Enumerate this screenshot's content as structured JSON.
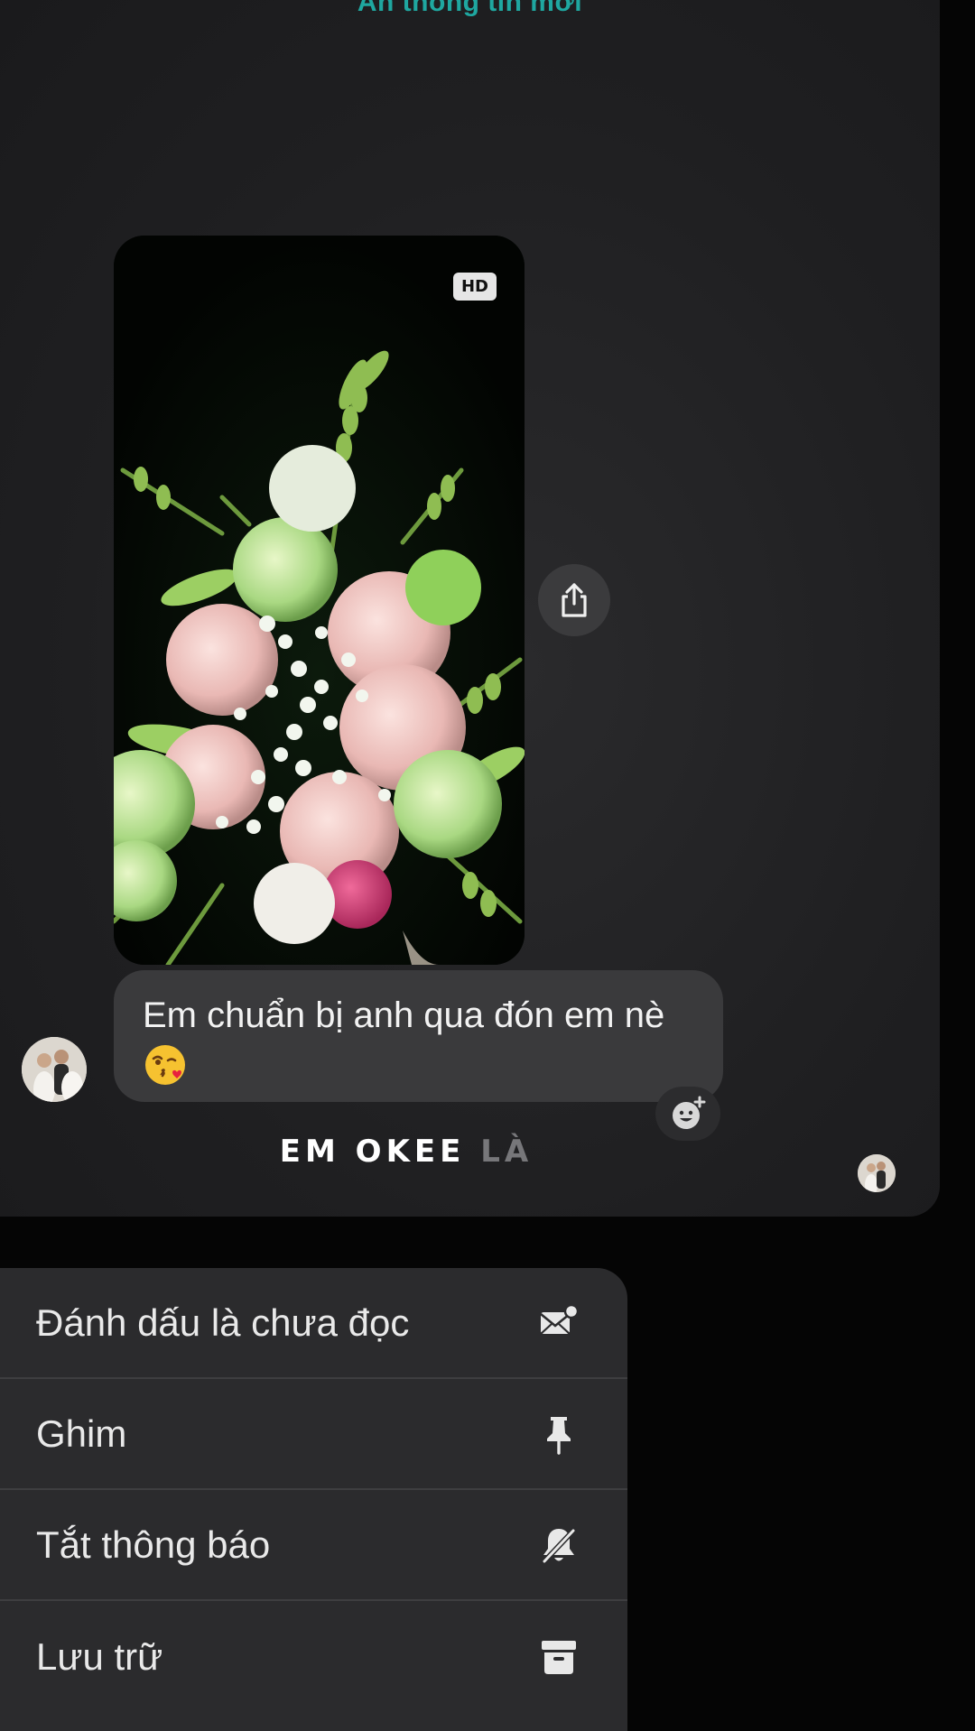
{
  "banner": {
    "new_info_label": "Ẩn thông tin mới"
  },
  "photo_message": {
    "hd_badge": "HD",
    "share_icon": "share-icon"
  },
  "text_message": {
    "text": "Em chuẩn bị anh qua đón em nè",
    "emoji": "face-blowing-a-kiss",
    "react_icon": "add-reaction-icon"
  },
  "caption": {
    "lit": "EM OKEE ",
    "dim": "LÀ"
  },
  "context_menu": {
    "items": [
      {
        "label": "Đánh dấu là chưa đọc",
        "icon": "mark-unread-icon"
      },
      {
        "label": "Ghim",
        "icon": "pin-icon"
      },
      {
        "label": "Tắt thông báo",
        "icon": "mute-bell-icon"
      },
      {
        "label": "Lưu trữ",
        "icon": "archive-icon"
      }
    ]
  },
  "colors": {
    "accent": "#1fa7a0",
    "bubble": "#3a3a3c",
    "menu_background": "#2b2b2d"
  }
}
